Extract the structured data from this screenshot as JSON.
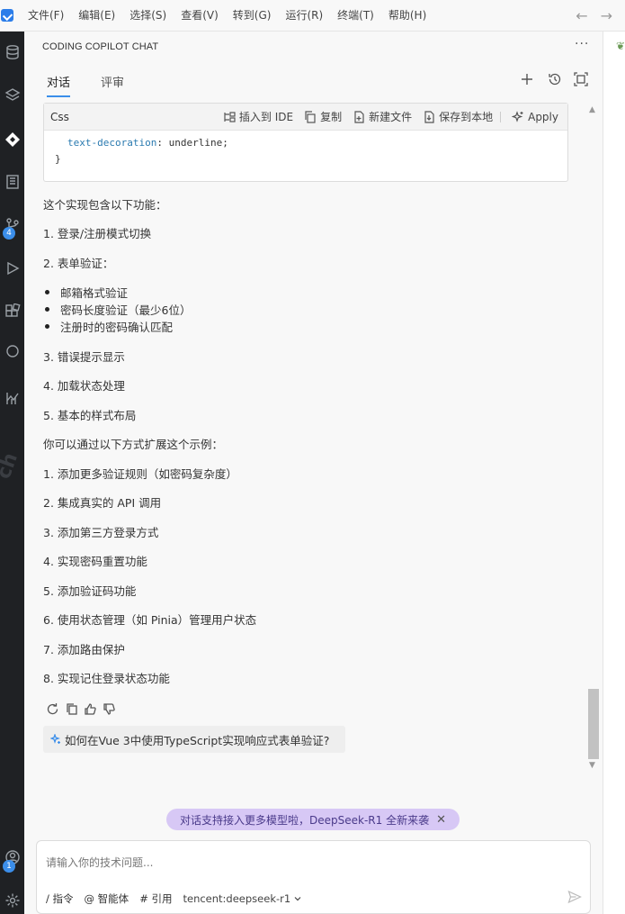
{
  "menu": [
    "文件(F)",
    "编辑(E)",
    "选择(S)",
    "查看(V)",
    "转到(G)",
    "运行(R)",
    "终端(T)",
    "帮助(H)"
  ],
  "activity": {
    "badge_top": "4",
    "badge_bottom": "1"
  },
  "panel": {
    "title": "CODING COPILOT CHAT",
    "more": "···",
    "tabs": [
      "对话",
      "评审"
    ]
  },
  "code": {
    "lang": "Css",
    "actions": [
      "插入到 IDE",
      "复制",
      "新建文件",
      "保存到本地",
      "Apply"
    ],
    "line1_prop": "text-decoration",
    "line1_rest": ": underline;",
    "line2": "}"
  },
  "answer": {
    "intro": "这个实现包含以下功能：",
    "items": [
      "1. 登录/注册模式切换",
      "2. 表单验证：",
      "3. 错误提示显示",
      "4. 加载状态处理",
      "5. 基本的样式布局"
    ],
    "bullets": [
      "邮箱格式验证",
      "密码长度验证（最少6位）",
      "注册时的密码确认匹配"
    ],
    "extend_intro": "你可以通过以下方式扩展这个示例：",
    "extend": [
      "1. 添加更多验证规则（如密码复杂度）",
      "2. 集成真实的 API 调用",
      "3. 添加第三方登录方式",
      "4. 实现密码重置功能",
      "5. 添加验证码功能",
      "6. 使用状态管理（如 Pinia）管理用户状态",
      "7. 添加路由保护",
      "8. 实现记住登录状态功能"
    ]
  },
  "suggestion": "如何在Vue 3中使用TypeScript实现响应式表单验证?",
  "banner": "对话支持接入更多模型啦，DeepSeek-R1 全新来袭",
  "input": {
    "placeholder": "请输入你的技术问题...",
    "tools": [
      "/ 指令",
      "@ 智能体",
      "# 引用"
    ],
    "model": "tencent:deepseek-r1"
  }
}
